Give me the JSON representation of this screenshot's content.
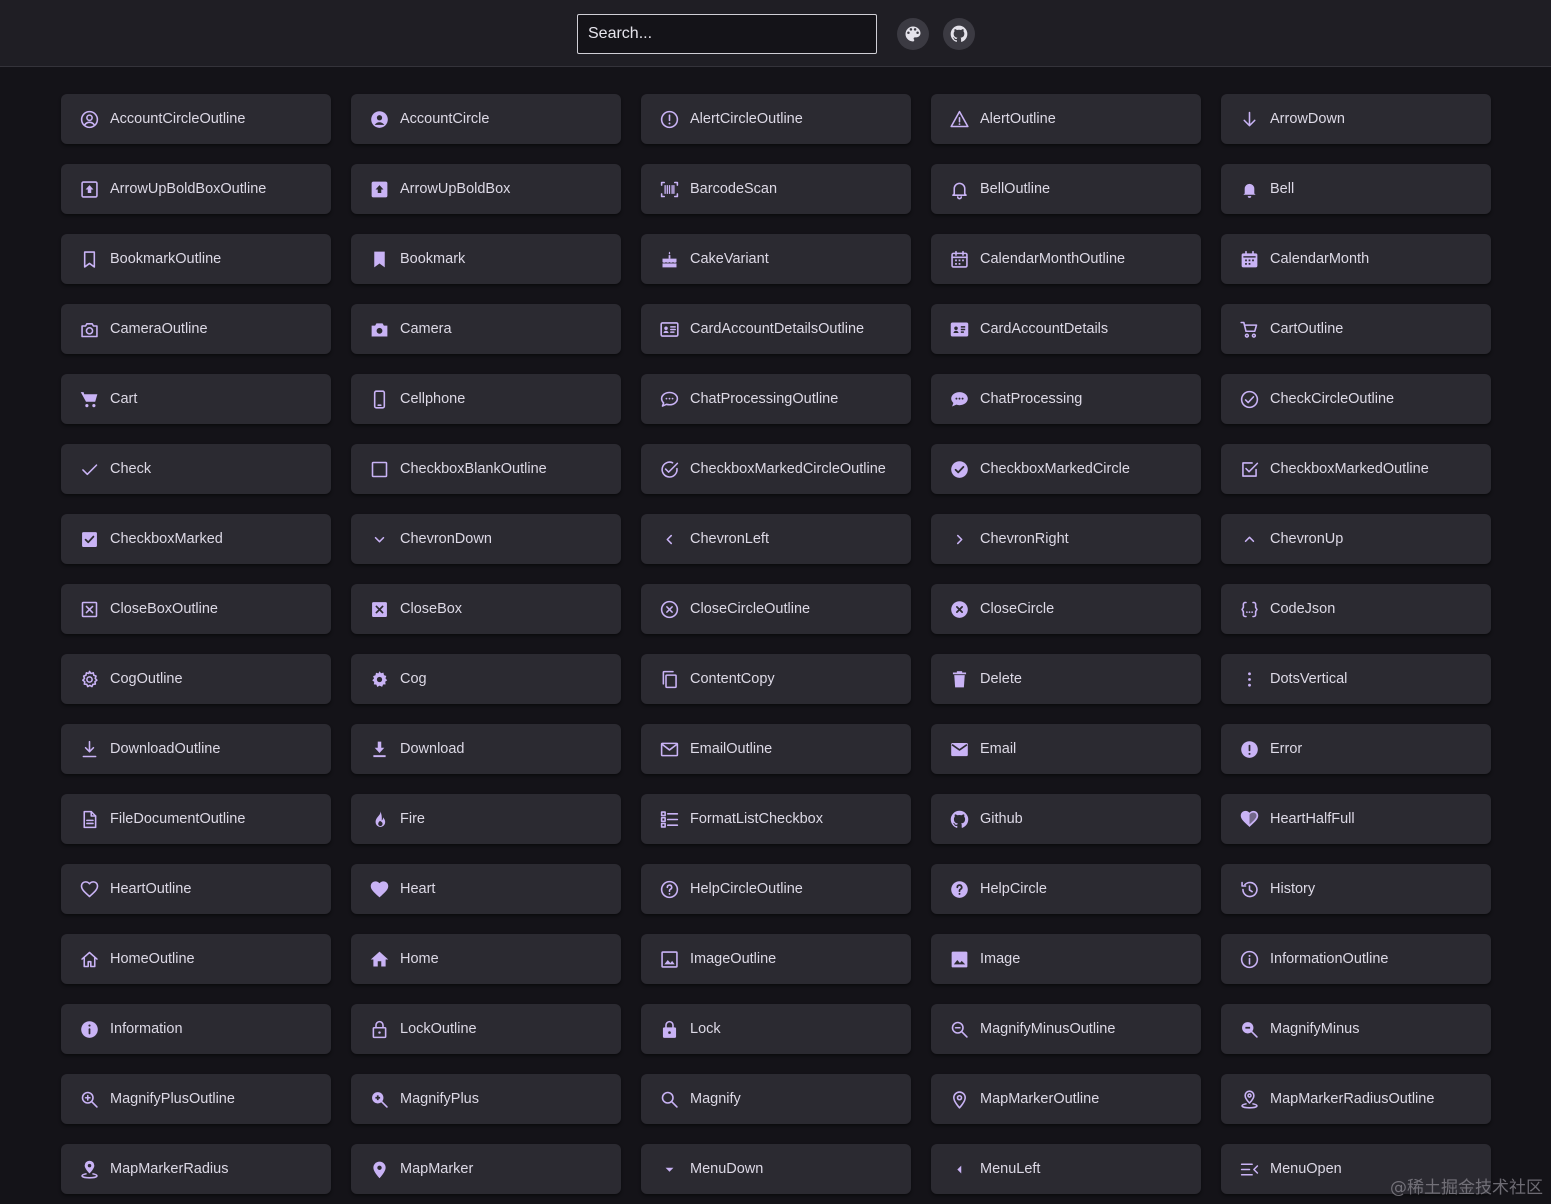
{
  "header": {
    "search_placeholder": "Search...",
    "theme_button": "palette-icon",
    "github_button": "github-icon"
  },
  "accent_color": "#c9b3f5",
  "items": [
    {
      "label": "AccountCircleOutline",
      "icon": "account-circle-outline"
    },
    {
      "label": "AccountCircle",
      "icon": "account-circle"
    },
    {
      "label": "AlertCircleOutline",
      "icon": "alert-circle-outline"
    },
    {
      "label": "AlertOutline",
      "icon": "alert-outline"
    },
    {
      "label": "ArrowDown",
      "icon": "arrow-down"
    },
    {
      "label": "ArrowUpBoldBoxOutline",
      "icon": "arrow-up-bold-box-outline"
    },
    {
      "label": "ArrowUpBoldBox",
      "icon": "arrow-up-bold-box"
    },
    {
      "label": "BarcodeScan",
      "icon": "barcode-scan"
    },
    {
      "label": "BellOutline",
      "icon": "bell-outline"
    },
    {
      "label": "Bell",
      "icon": "bell"
    },
    {
      "label": "BookmarkOutline",
      "icon": "bookmark-outline"
    },
    {
      "label": "Bookmark",
      "icon": "bookmark"
    },
    {
      "label": "CakeVariant",
      "icon": "cake-variant"
    },
    {
      "label": "CalendarMonthOutline",
      "icon": "calendar-month-outline"
    },
    {
      "label": "CalendarMonth",
      "icon": "calendar-month"
    },
    {
      "label": "CameraOutline",
      "icon": "camera-outline"
    },
    {
      "label": "Camera",
      "icon": "camera"
    },
    {
      "label": "CardAccountDetailsOutline",
      "icon": "card-account-details-outline"
    },
    {
      "label": "CardAccountDetails",
      "icon": "card-account-details"
    },
    {
      "label": "CartOutline",
      "icon": "cart-outline"
    },
    {
      "label": "Cart",
      "icon": "cart"
    },
    {
      "label": "Cellphone",
      "icon": "cellphone"
    },
    {
      "label": "ChatProcessingOutline",
      "icon": "chat-processing-outline"
    },
    {
      "label": "ChatProcessing",
      "icon": "chat-processing"
    },
    {
      "label": "CheckCircleOutline",
      "icon": "check-circle-outline"
    },
    {
      "label": "Check",
      "icon": "check"
    },
    {
      "label": "CheckboxBlankOutline",
      "icon": "checkbox-blank-outline"
    },
    {
      "label": "CheckboxMarkedCircleOutline",
      "icon": "checkbox-marked-circle-outline"
    },
    {
      "label": "CheckboxMarkedCircle",
      "icon": "checkbox-marked-circle"
    },
    {
      "label": "CheckboxMarkedOutline",
      "icon": "checkbox-marked-outline"
    },
    {
      "label": "CheckboxMarked",
      "icon": "checkbox-marked"
    },
    {
      "label": "ChevronDown",
      "icon": "chevron-down"
    },
    {
      "label": "ChevronLeft",
      "icon": "chevron-left"
    },
    {
      "label": "ChevronRight",
      "icon": "chevron-right"
    },
    {
      "label": "ChevronUp",
      "icon": "chevron-up"
    },
    {
      "label": "CloseBoxOutline",
      "icon": "close-box-outline"
    },
    {
      "label": "CloseBox",
      "icon": "close-box"
    },
    {
      "label": "CloseCircleOutline",
      "icon": "close-circle-outline"
    },
    {
      "label": "CloseCircle",
      "icon": "close-circle"
    },
    {
      "label": "CodeJson",
      "icon": "code-json"
    },
    {
      "label": "CogOutline",
      "icon": "cog-outline"
    },
    {
      "label": "Cog",
      "icon": "cog"
    },
    {
      "label": "ContentCopy",
      "icon": "content-copy"
    },
    {
      "label": "Delete",
      "icon": "delete"
    },
    {
      "label": "DotsVertical",
      "icon": "dots-vertical"
    },
    {
      "label": "DownloadOutline",
      "icon": "download-outline"
    },
    {
      "label": "Download",
      "icon": "download"
    },
    {
      "label": "EmailOutline",
      "icon": "email-outline"
    },
    {
      "label": "Email",
      "icon": "email"
    },
    {
      "label": "Error",
      "icon": "error"
    },
    {
      "label": "FileDocumentOutline",
      "icon": "file-document-outline"
    },
    {
      "label": "Fire",
      "icon": "fire"
    },
    {
      "label": "FormatListCheckbox",
      "icon": "format-list-checkbox"
    },
    {
      "label": "Github",
      "icon": "github"
    },
    {
      "label": "HeartHalfFull",
      "icon": "heart-half-full"
    },
    {
      "label": "HeartOutline",
      "icon": "heart-outline"
    },
    {
      "label": "Heart",
      "icon": "heart"
    },
    {
      "label": "HelpCircleOutline",
      "icon": "help-circle-outline"
    },
    {
      "label": "HelpCircle",
      "icon": "help-circle"
    },
    {
      "label": "History",
      "icon": "history"
    },
    {
      "label": "HomeOutline",
      "icon": "home-outline"
    },
    {
      "label": "Home",
      "icon": "home"
    },
    {
      "label": "ImageOutline",
      "icon": "image-outline"
    },
    {
      "label": "Image",
      "icon": "image"
    },
    {
      "label": "InformationOutline",
      "icon": "information-outline"
    },
    {
      "label": "Information",
      "icon": "information"
    },
    {
      "label": "LockOutline",
      "icon": "lock-outline"
    },
    {
      "label": "Lock",
      "icon": "lock"
    },
    {
      "label": "MagnifyMinusOutline",
      "icon": "magnify-minus-outline"
    },
    {
      "label": "MagnifyMinus",
      "icon": "magnify-minus"
    },
    {
      "label": "MagnifyPlusOutline",
      "icon": "magnify-plus-outline"
    },
    {
      "label": "MagnifyPlus",
      "icon": "magnify-plus"
    },
    {
      "label": "Magnify",
      "icon": "magnify"
    },
    {
      "label": "MapMarkerOutline",
      "icon": "map-marker-outline"
    },
    {
      "label": "MapMarkerRadiusOutline",
      "icon": "map-marker-radius-outline"
    },
    {
      "label": "MapMarkerRadius",
      "icon": "map-marker-radius"
    },
    {
      "label": "MapMarker",
      "icon": "map-marker"
    },
    {
      "label": "MenuDown",
      "icon": "menu-down"
    },
    {
      "label": "MenuLeft",
      "icon": "menu-left"
    },
    {
      "label": "MenuOpen",
      "icon": "menu-open"
    }
  ],
  "watermark": "@稀土掘金技术社区"
}
